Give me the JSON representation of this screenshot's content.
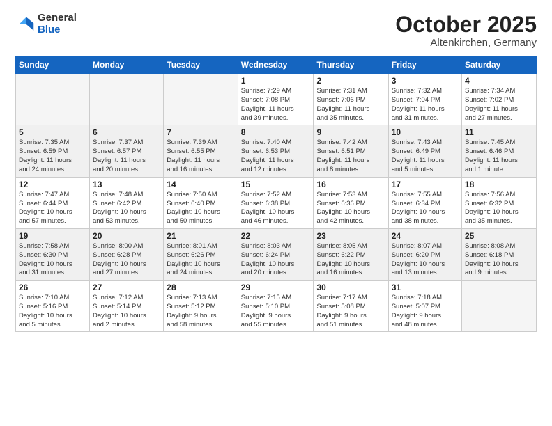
{
  "logo": {
    "general": "General",
    "blue": "Blue"
  },
  "title": {
    "month": "October 2025",
    "location": "Altenkirchen, Germany"
  },
  "weekdays": [
    "Sunday",
    "Monday",
    "Tuesday",
    "Wednesday",
    "Thursday",
    "Friday",
    "Saturday"
  ],
  "rows": [
    [
      {
        "day": "",
        "info": ""
      },
      {
        "day": "",
        "info": ""
      },
      {
        "day": "",
        "info": ""
      },
      {
        "day": "1",
        "info": "Sunrise: 7:29 AM\nSunset: 7:08 PM\nDaylight: 11 hours\nand 39 minutes."
      },
      {
        "day": "2",
        "info": "Sunrise: 7:31 AM\nSunset: 7:06 PM\nDaylight: 11 hours\nand 35 minutes."
      },
      {
        "day": "3",
        "info": "Sunrise: 7:32 AM\nSunset: 7:04 PM\nDaylight: 11 hours\nand 31 minutes."
      },
      {
        "day": "4",
        "info": "Sunrise: 7:34 AM\nSunset: 7:02 PM\nDaylight: 11 hours\nand 27 minutes."
      }
    ],
    [
      {
        "day": "5",
        "info": "Sunrise: 7:35 AM\nSunset: 6:59 PM\nDaylight: 11 hours\nand 24 minutes."
      },
      {
        "day": "6",
        "info": "Sunrise: 7:37 AM\nSunset: 6:57 PM\nDaylight: 11 hours\nand 20 minutes."
      },
      {
        "day": "7",
        "info": "Sunrise: 7:39 AM\nSunset: 6:55 PM\nDaylight: 11 hours\nand 16 minutes."
      },
      {
        "day": "8",
        "info": "Sunrise: 7:40 AM\nSunset: 6:53 PM\nDaylight: 11 hours\nand 12 minutes."
      },
      {
        "day": "9",
        "info": "Sunrise: 7:42 AM\nSunset: 6:51 PM\nDaylight: 11 hours\nand 8 minutes."
      },
      {
        "day": "10",
        "info": "Sunrise: 7:43 AM\nSunset: 6:49 PM\nDaylight: 11 hours\nand 5 minutes."
      },
      {
        "day": "11",
        "info": "Sunrise: 7:45 AM\nSunset: 6:46 PM\nDaylight: 11 hours\nand 1 minute."
      }
    ],
    [
      {
        "day": "12",
        "info": "Sunrise: 7:47 AM\nSunset: 6:44 PM\nDaylight: 10 hours\nand 57 minutes."
      },
      {
        "day": "13",
        "info": "Sunrise: 7:48 AM\nSunset: 6:42 PM\nDaylight: 10 hours\nand 53 minutes."
      },
      {
        "day": "14",
        "info": "Sunrise: 7:50 AM\nSunset: 6:40 PM\nDaylight: 10 hours\nand 50 minutes."
      },
      {
        "day": "15",
        "info": "Sunrise: 7:52 AM\nSunset: 6:38 PM\nDaylight: 10 hours\nand 46 minutes."
      },
      {
        "day": "16",
        "info": "Sunrise: 7:53 AM\nSunset: 6:36 PM\nDaylight: 10 hours\nand 42 minutes."
      },
      {
        "day": "17",
        "info": "Sunrise: 7:55 AM\nSunset: 6:34 PM\nDaylight: 10 hours\nand 38 minutes."
      },
      {
        "day": "18",
        "info": "Sunrise: 7:56 AM\nSunset: 6:32 PM\nDaylight: 10 hours\nand 35 minutes."
      }
    ],
    [
      {
        "day": "19",
        "info": "Sunrise: 7:58 AM\nSunset: 6:30 PM\nDaylight: 10 hours\nand 31 minutes."
      },
      {
        "day": "20",
        "info": "Sunrise: 8:00 AM\nSunset: 6:28 PM\nDaylight: 10 hours\nand 27 minutes."
      },
      {
        "day": "21",
        "info": "Sunrise: 8:01 AM\nSunset: 6:26 PM\nDaylight: 10 hours\nand 24 minutes."
      },
      {
        "day": "22",
        "info": "Sunrise: 8:03 AM\nSunset: 6:24 PM\nDaylight: 10 hours\nand 20 minutes."
      },
      {
        "day": "23",
        "info": "Sunrise: 8:05 AM\nSunset: 6:22 PM\nDaylight: 10 hours\nand 16 minutes."
      },
      {
        "day": "24",
        "info": "Sunrise: 8:07 AM\nSunset: 6:20 PM\nDaylight: 10 hours\nand 13 minutes."
      },
      {
        "day": "25",
        "info": "Sunrise: 8:08 AM\nSunset: 6:18 PM\nDaylight: 10 hours\nand 9 minutes."
      }
    ],
    [
      {
        "day": "26",
        "info": "Sunrise: 7:10 AM\nSunset: 5:16 PM\nDaylight: 10 hours\nand 5 minutes."
      },
      {
        "day": "27",
        "info": "Sunrise: 7:12 AM\nSunset: 5:14 PM\nDaylight: 10 hours\nand 2 minutes."
      },
      {
        "day": "28",
        "info": "Sunrise: 7:13 AM\nSunset: 5:12 PM\nDaylight: 9 hours\nand 58 minutes."
      },
      {
        "day": "29",
        "info": "Sunrise: 7:15 AM\nSunset: 5:10 PM\nDaylight: 9 hours\nand 55 minutes."
      },
      {
        "day": "30",
        "info": "Sunrise: 7:17 AM\nSunset: 5:08 PM\nDaylight: 9 hours\nand 51 minutes."
      },
      {
        "day": "31",
        "info": "Sunrise: 7:18 AM\nSunset: 5:07 PM\nDaylight: 9 hours\nand 48 minutes."
      },
      {
        "day": "",
        "info": ""
      }
    ]
  ]
}
